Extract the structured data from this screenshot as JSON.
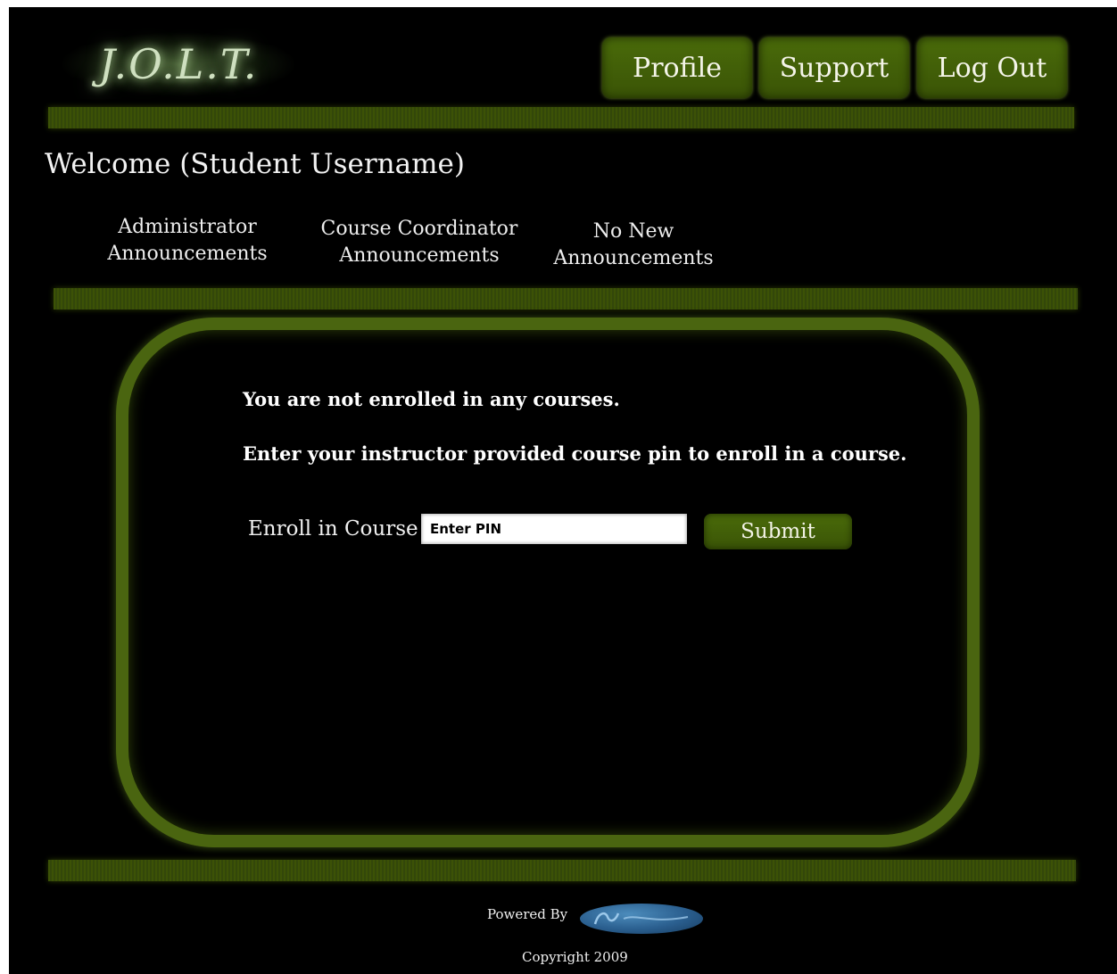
{
  "header": {
    "logo_text": "J.O.L.T.",
    "nav": {
      "profile": "Profile",
      "support": "Support",
      "logout": "Log Out"
    }
  },
  "welcome": "Welcome (Student Username)",
  "announcements": {
    "admin": "Administrator Announcements",
    "coordinator": "Course Coordinator Announcements",
    "none": "No New Announcements"
  },
  "main": {
    "not_enrolled": "You are not enrolled in any courses.",
    "instructions": "Enter your instructor provided course pin to enroll in a course.",
    "enroll_label": "Enroll in Course",
    "pin_placeholder": "Enter PIN",
    "pin_value": "",
    "submit_label": "Submit"
  },
  "footer": {
    "powered_by": "Powered By",
    "powered_logo_icon": "company-logo-icon",
    "copyright": "Copyright 2009"
  },
  "colors": {
    "background": "#000000",
    "accent_green": "#4a6b0a",
    "text": "#f0f0f0"
  }
}
